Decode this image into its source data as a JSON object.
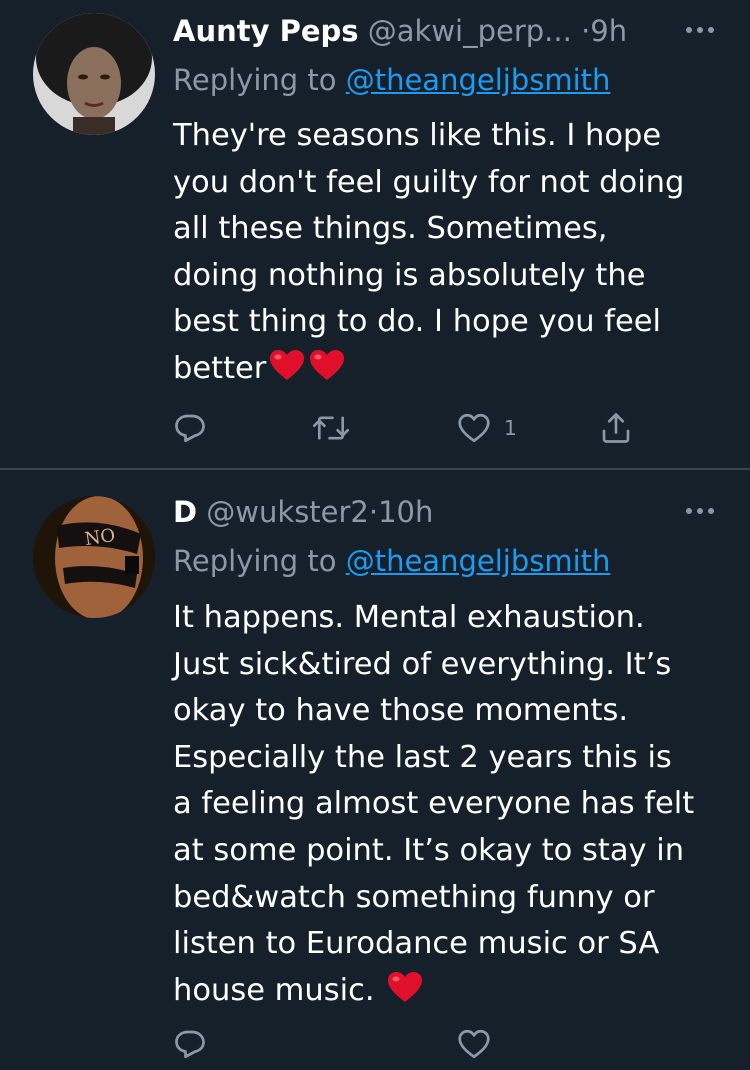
{
  "tweets": [
    {
      "display_name": "Aunty Peps",
      "handle": "@akwi_perp...",
      "separator": "·",
      "time": "9h",
      "replying_label": "Replying to",
      "replying_handle": "@theangeljbsmith",
      "text": "They're seasons like this. I hope\nyou don't feel guilty for not doing\nall these things. Sometimes,\ndoing nothing is absolutely the\nbest thing to do. I hope you feel\nbetter",
      "trailing_emoji": [
        "heart",
        "heart"
      ],
      "actions": {
        "reply_icon": "reply-icon",
        "retweet_icon": "retweet-icon",
        "like_icon": "heart-icon",
        "like_count": "1",
        "share_icon": "share-icon"
      }
    },
    {
      "display_name": "D",
      "handle": "@wukster2",
      "separator": "·",
      "time": "10h",
      "replying_label": "Replying to",
      "replying_handle": "@theangeljbsmith",
      "text": "It happens. Mental exhaustion.\nJust sick&tired of everything. It’s\nokay to have those moments.\nEspecially the last 2 years this is\na feeling almost everyone has felt\nat some point. It’s okay to stay in\nbed&watch something funny or\nlisten to Eurodance music or SA\nhouse music.",
      "trailing_emoji": [
        "heart"
      ]
    }
  ],
  "colors": {
    "background": "#15202b",
    "secondary_text": "#8b98a5",
    "link": "#1d9bf0",
    "divider": "#38444d",
    "heart_emoji": "#e0102a"
  }
}
